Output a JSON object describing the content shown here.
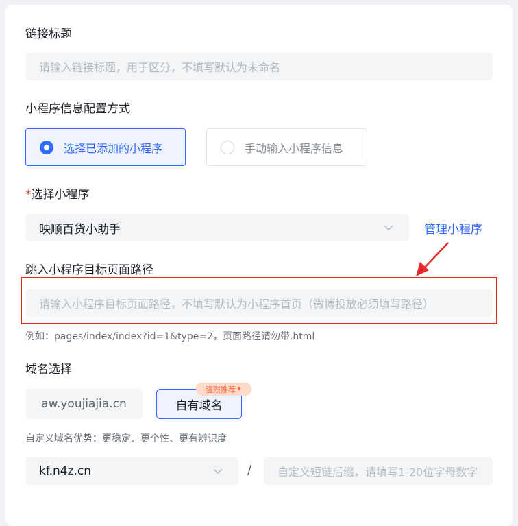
{
  "link_title": {
    "label": "链接标题",
    "placeholder": "请输入链接标题，用于区分，不填写默认为未命名"
  },
  "config_mode": {
    "label": "小程序信息配置方式",
    "options": [
      {
        "label": "选择已添加的小程序",
        "selected": true
      },
      {
        "label": "手动输入小程序信息",
        "selected": false
      }
    ]
  },
  "mini_program": {
    "required_mark": "*",
    "label": "选择小程序",
    "selected_value": "映顺百货小助手",
    "manage_link": "管理小程序"
  },
  "target_path": {
    "label": "跳入小程序目标页面路径",
    "placeholder": "请输入小程序目标页面路径，不填写默认为小程序首页（微博投放必须填写路径）",
    "example": "例如：pages/index/index?id=1&type=2，页面路径请勿带.html"
  },
  "domain": {
    "label": "域名选择",
    "options": [
      "aw.youjiajia.cn",
      "自有域名"
    ],
    "recommend_badge": "强烈推荐",
    "advantage_hint": "自定义域名优势：更稳定、更个性、更有辨识度",
    "selected_domain": "kf.n4z.cn",
    "separator": "/",
    "suffix_placeholder": "自定义短链后缀，请填写1-20位字母数字"
  },
  "colors": {
    "accent": "#2f6bff",
    "highlight_box": "#e62a2a",
    "badge_bg": "#ffd9c9",
    "badge_text": "#ff6a3d"
  }
}
